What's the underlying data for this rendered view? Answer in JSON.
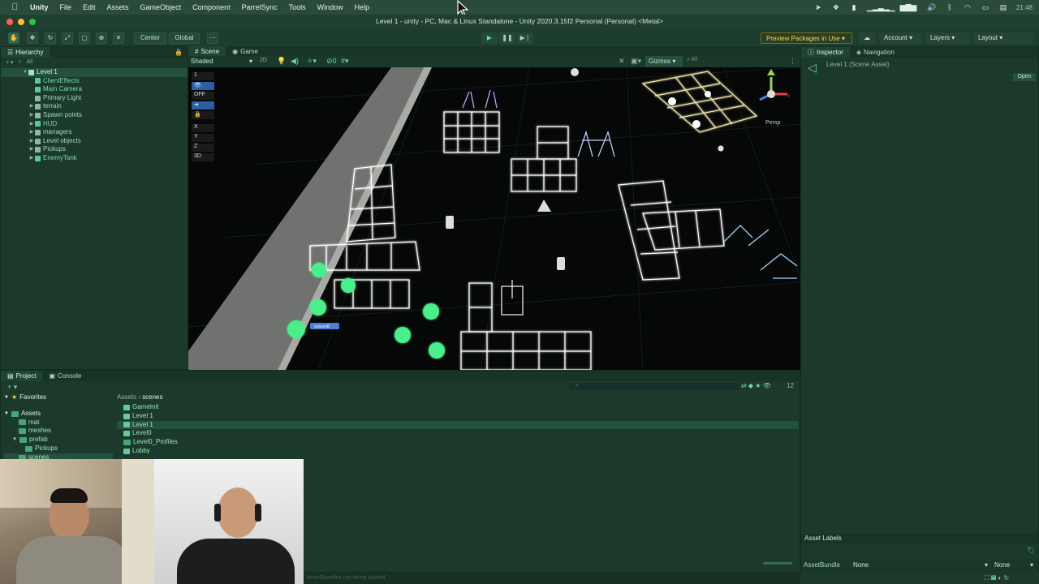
{
  "menubar": {
    "app": "Unity",
    "items": [
      "File",
      "Edit",
      "Assets",
      "GameObject",
      "Component",
      "ParrelSync",
      "Tools",
      "Window",
      "Help"
    ],
    "clock": "21:48"
  },
  "window": {
    "title": "Level 1 - unity - PC, Mac & Linux Standalone - Unity 2020.3.15f2 Personal (Personal) <Metal>"
  },
  "toolbar": {
    "pivot_label": "Center",
    "space_label": "Global",
    "preview_packages": "Preview Packages in Use",
    "account": "Account",
    "layers": "Layers",
    "layout": "Layout"
  },
  "hierarchy": {
    "tab": "Hierarchy",
    "search_placeholder": "All",
    "root": "Level 1",
    "items": [
      "ClientEffects",
      "Main Camera",
      "Primary Light",
      "terrain",
      "Spawn points",
      "HUD",
      "managers",
      "Level objects",
      "Pickups",
      "EnemyTank"
    ]
  },
  "scene": {
    "tabs": [
      "Scene",
      "Game"
    ],
    "shading": "Shaded",
    "mode_2d": "2D",
    "gizmos": "Gizmos",
    "search_placeholder": "All",
    "persp": "Persp",
    "overlay_labels": [
      "1",
      "OFF",
      "X",
      "Y",
      "Z",
      "3D"
    ],
    "spawn_label": "spawnB"
  },
  "inspector": {
    "tabs": [
      "Inspector",
      "Navigation"
    ],
    "asset_title": "Level 1 (Scene Asset)",
    "open_button": "Open",
    "asset_labels": "Asset Labels",
    "assetbundle_label": "AssetBundle",
    "assetbundle_value": "None",
    "variant_value": "None"
  },
  "project": {
    "tabs": [
      "Project",
      "Console"
    ],
    "breadcrumb": [
      "Assets",
      "scenes"
    ],
    "favorites": "Favorites",
    "tree": [
      "Assets",
      "mat",
      "meshes",
      "prefab",
      "Pickups",
      "scenes"
    ],
    "files": [
      "GameInit",
      "Level 1",
      "Level 1",
      "Level0",
      "Level0_Profiles",
      "Lobby"
    ],
    "count": "12",
    "status": "AssetBundles not being loaded"
  },
  "colors": {
    "accent": "#3ff28b",
    "panel_bg": "#1b3a2c",
    "scene_bg": "#050806"
  }
}
